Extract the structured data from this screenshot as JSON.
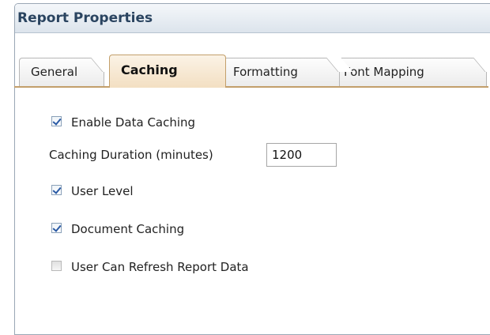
{
  "dialog": {
    "title": "Report Properties"
  },
  "tabs": [
    {
      "label": "General",
      "active": false
    },
    {
      "label": "Caching",
      "active": true
    },
    {
      "label": "Formatting",
      "active": false
    },
    {
      "label": "Font Mapping",
      "active": false
    }
  ],
  "caching": {
    "enable_data_caching": {
      "label": "Enable Data Caching",
      "checked": true
    },
    "caching_duration": {
      "label": "Caching Duration (minutes)",
      "value": "1200"
    },
    "user_level": {
      "label": "User Level",
      "checked": true
    },
    "document_caching": {
      "label": "Document Caching",
      "checked": true
    },
    "user_can_refresh": {
      "label": "User Can Refresh Report Data",
      "checked": false
    }
  },
  "colors": {
    "title_text": "#2a4460",
    "active_tab": "#f3dfc2",
    "tab_underline": "#c39f6b",
    "checkmark": "#2a5aa5"
  }
}
